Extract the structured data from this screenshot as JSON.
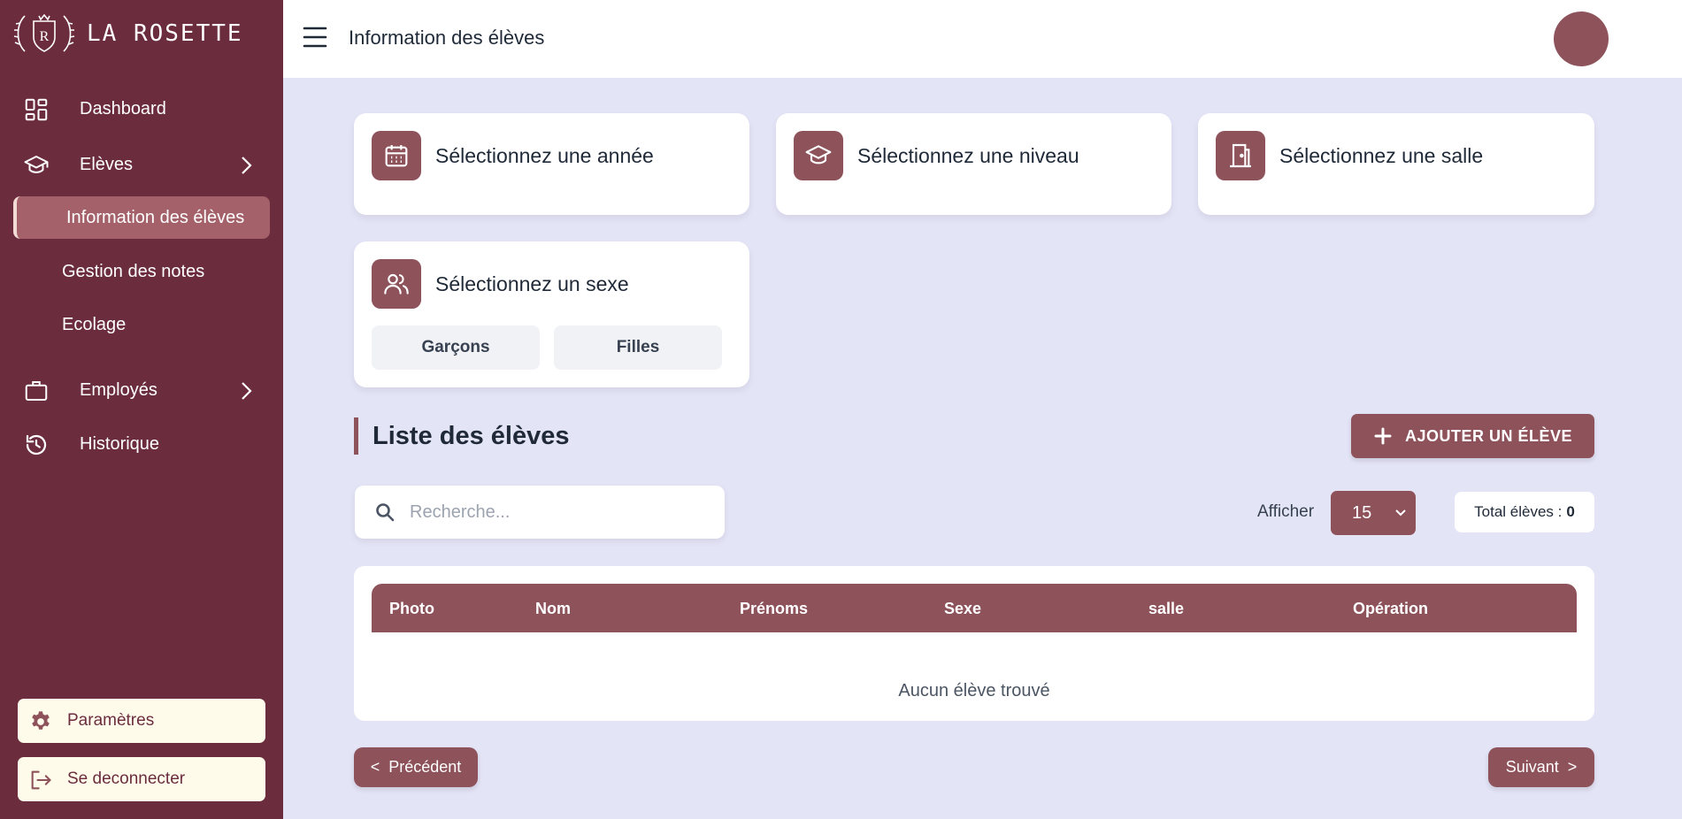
{
  "brand": {
    "name": "LA ROSETTE",
    "logo_letter": "R"
  },
  "sidebar": {
    "items": [
      {
        "label": "Dashboard",
        "icon": "dashboard-grid-icon"
      },
      {
        "label": "Elèves",
        "icon": "graduation-cap-icon"
      },
      {
        "label": "Employés",
        "icon": "briefcase-icon"
      },
      {
        "label": "Historique",
        "icon": "history-icon"
      }
    ],
    "subitems": [
      {
        "label": "Information des élèves",
        "active": true
      },
      {
        "label": "Gestion des notes"
      },
      {
        "label": "Ecolage"
      }
    ],
    "settings_label": "Paramètres",
    "logout_label": "Se deconnecter"
  },
  "header": {
    "title": "Information des élèves"
  },
  "filters": {
    "year": "Sélectionnez une année",
    "level": "Sélectionnez une niveau",
    "room": "Sélectionnez une salle",
    "sex": "Sélectionnez un sexe",
    "boys": "Garçons",
    "girls": "Filles"
  },
  "list": {
    "title": "Liste des élèves",
    "add_label": "AJOUTER UN ÉLÈVE",
    "search_placeholder": "Recherche...",
    "show_label": "Afficher",
    "show_value": "15",
    "total_label": "Total élèves :",
    "total_value": "0",
    "columns": [
      "Photo",
      "Nom",
      "Prénoms",
      "Sexe",
      "salle",
      "Opération"
    ],
    "empty_text": "Aucun élève trouvé",
    "prev_label": "Précédent",
    "next_label": "Suivant"
  },
  "colors": {
    "sidebar": "#6b2d3e",
    "accent": "#8e525b",
    "active_item": "#a4616a",
    "background": "#e4e4f7",
    "bottom_button": "#fffbeb"
  }
}
